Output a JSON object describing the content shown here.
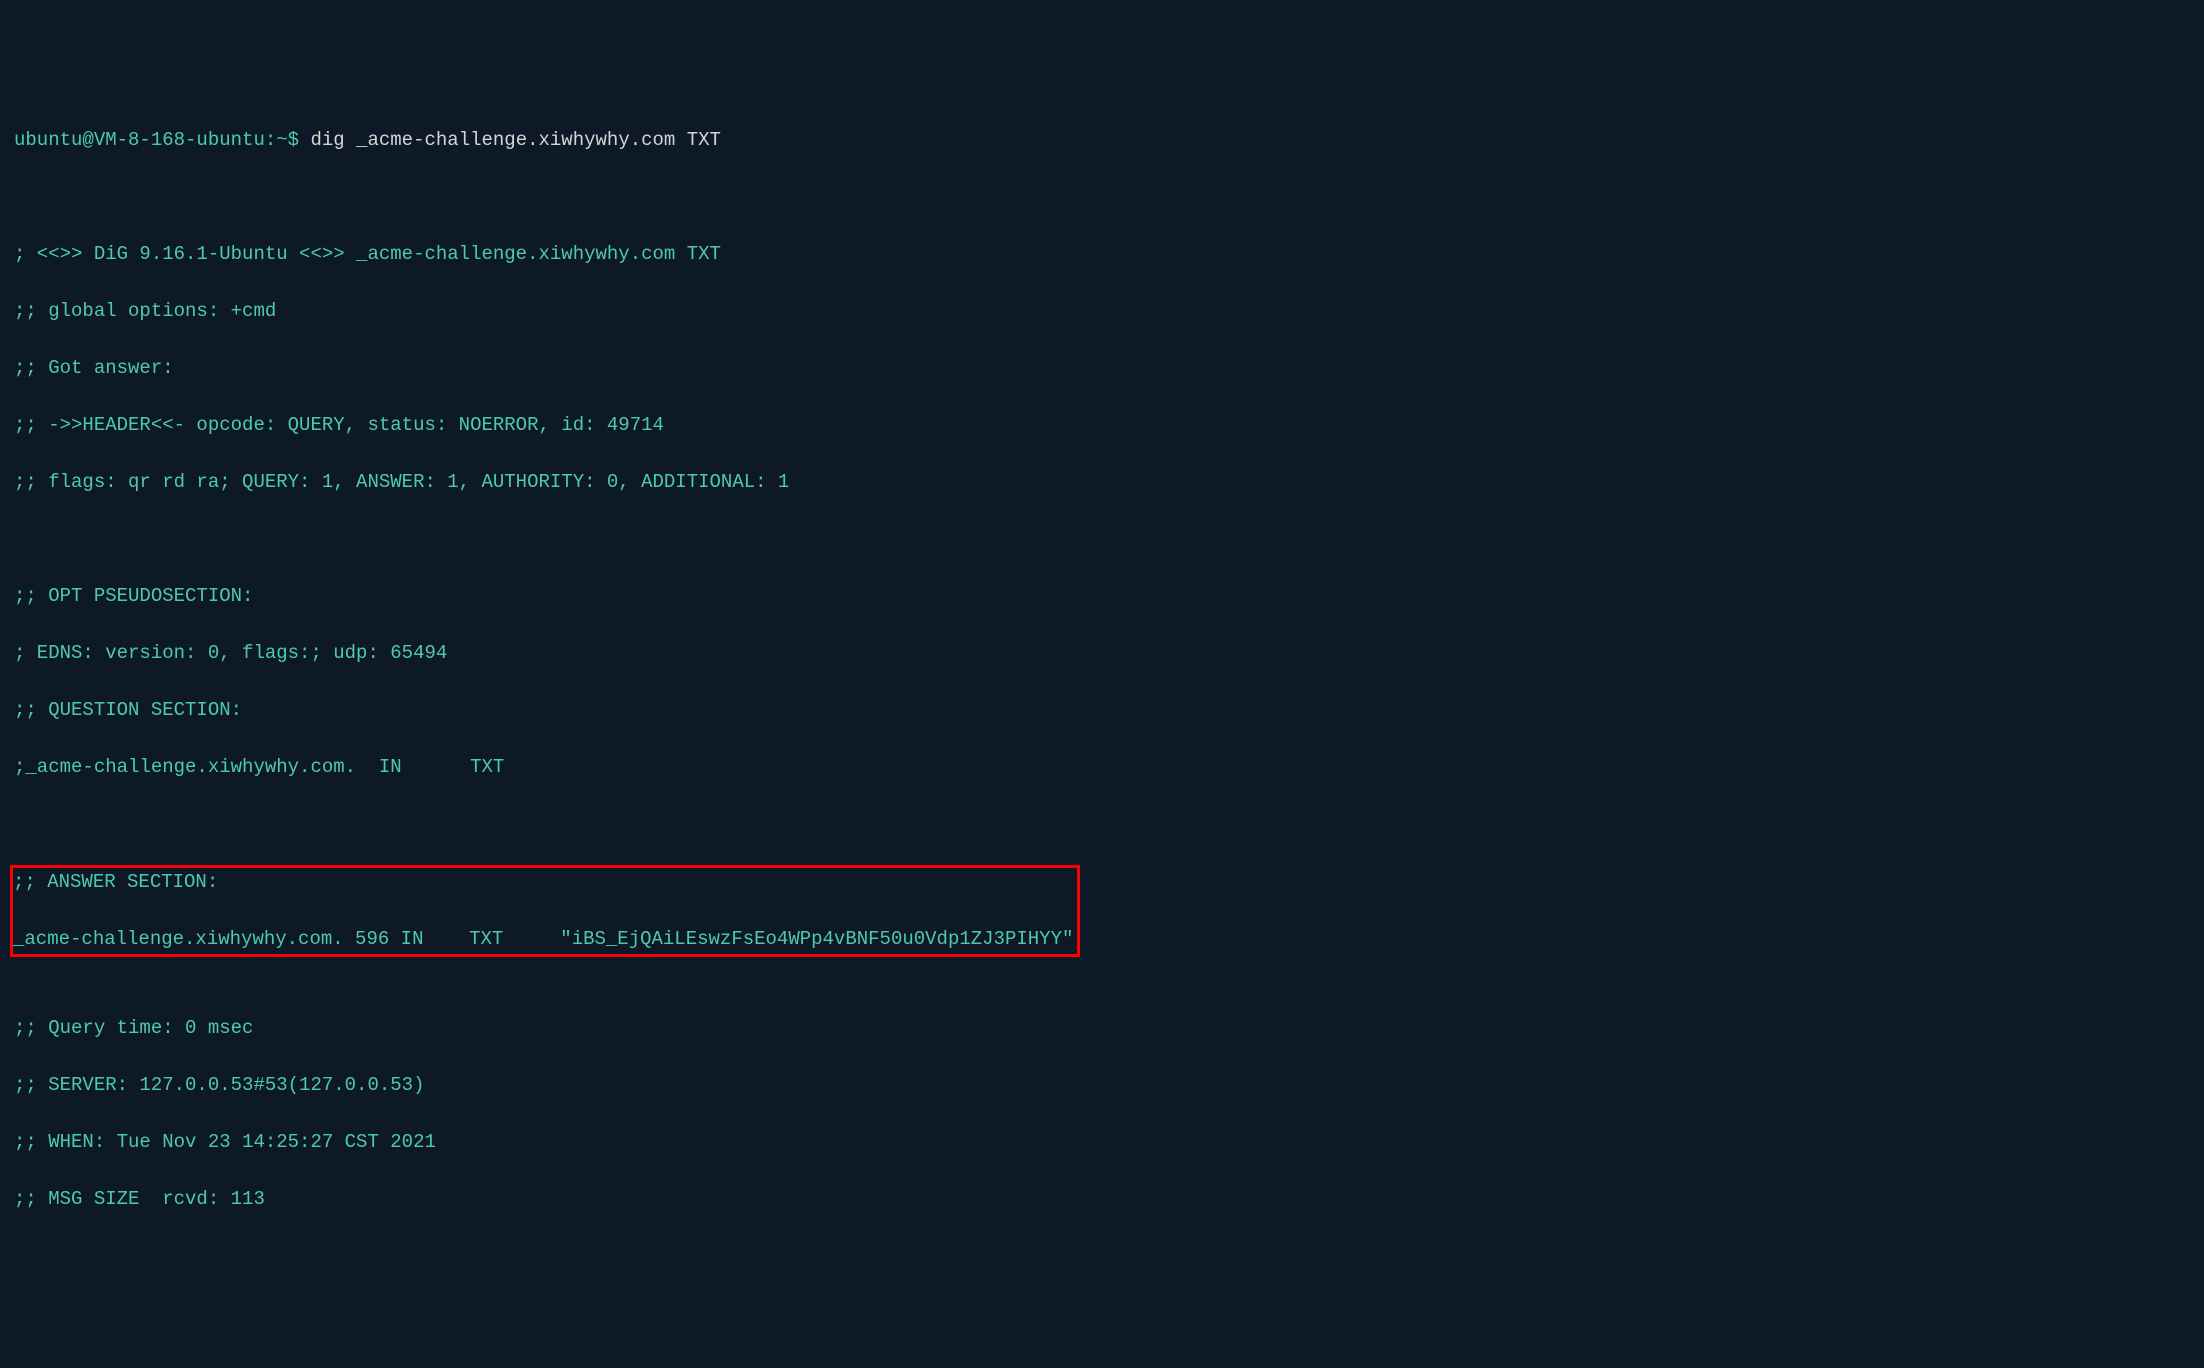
{
  "prompt": {
    "user": "ubuntu@VM-8-168-ubuntu",
    "separator": ":",
    "path": "~",
    "symbol": "$"
  },
  "command": "dig _acme-challenge.xiwhywhy.com TXT",
  "output": {
    "banner": "; <<>> DiG 9.16.1-Ubuntu <<>> _acme-challenge.xiwhywhy.com TXT",
    "global_options": ";; global options: +cmd",
    "got_answer": ";; Got answer:",
    "header": ";; ->>HEADER<<- opcode: QUERY, status: NOERROR, id: 49714",
    "flags": ";; flags: qr rd ra; QUERY: 1, ANSWER: 1, AUTHORITY: 0, ADDITIONAL: 1",
    "opt_section_header": ";; OPT PSEUDOSECTION:",
    "edns": "; EDNS: version: 0, flags:; udp: 65494",
    "question_section_header": ";; QUESTION SECTION:",
    "question": ";_acme-challenge.xiwhywhy.com.  IN      TXT",
    "answer_section_header": ";; ANSWER SECTION:",
    "answer_record": "_acme-challenge.xiwhywhy.com. 596 IN    TXT     \"iBS_EjQAiLEswzFsEo4WPp4vBNF50u0Vdp1ZJ3PIHYY\"",
    "query_time": ";; Query time: 0 msec",
    "server": ";; SERVER: 127.0.0.53#53(127.0.0.53)",
    "when": ";; WHEN: Tue Nov 23 14:25:27 CST 2021",
    "msg_size": ";; MSG SIZE  rcvd: 113"
  }
}
